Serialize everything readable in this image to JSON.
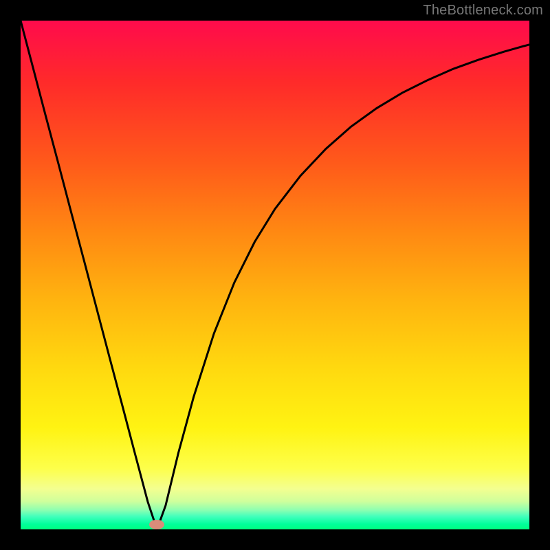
{
  "watermark": "TheBottleneck.com",
  "chart_data": {
    "type": "line",
    "title": "",
    "xlabel": "",
    "ylabel": "",
    "xlim": [
      0,
      1
    ],
    "ylim": [
      0,
      1
    ],
    "x": [
      0.0,
      0.025,
      0.05,
      0.075,
      0.1,
      0.125,
      0.15,
      0.175,
      0.2,
      0.225,
      0.25,
      0.268,
      0.285,
      0.31,
      0.34,
      0.38,
      0.42,
      0.46,
      0.5,
      0.55,
      0.6,
      0.65,
      0.7,
      0.75,
      0.8,
      0.85,
      0.9,
      0.95,
      1.0
    ],
    "y": [
      1.0,
      0.905,
      0.81,
      0.716,
      0.621,
      0.527,
      0.432,
      0.337,
      0.243,
      0.148,
      0.054,
      0.0,
      0.047,
      0.15,
      0.26,
      0.385,
      0.485,
      0.565,
      0.63,
      0.695,
      0.748,
      0.792,
      0.828,
      0.858,
      0.883,
      0.905,
      0.923,
      0.939,
      0.953
    ],
    "series": [
      {
        "name": "curve",
        "color": "#000000"
      }
    ],
    "marker": {
      "x": 0.268,
      "y": 0.01,
      "color": "#d98c7a"
    }
  },
  "colors": {
    "frame": "#000000",
    "gradient_top": "#ff0b4c",
    "gradient_bottom": "#00ff7f",
    "curve": "#000000",
    "marker": "#d98c7a",
    "watermark": "#777777"
  }
}
